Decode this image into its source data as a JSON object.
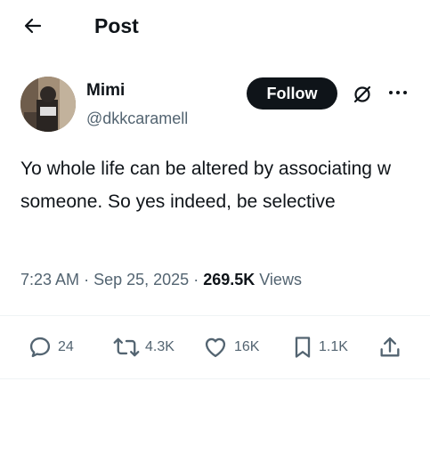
{
  "header": {
    "title": "Post"
  },
  "author": {
    "name": "Mimi",
    "handle": "@dkkcaramell"
  },
  "buttons": {
    "follow_label": "Follow"
  },
  "post": {
    "text": "Yo whole life can be altered by associating w someone. So yes indeed, be selective",
    "time": "7:23 AM",
    "date": "Sep 25, 2025",
    "views_count": "269.5K",
    "views_label": "Views"
  },
  "engagement": {
    "replies": "24",
    "reposts": "4.3K",
    "likes": "16K",
    "bookmarks": "1.1K"
  },
  "icons": [
    "back-arrow-icon",
    "grok-icon",
    "more-icon",
    "reply-icon",
    "repost-icon",
    "like-icon",
    "bookmark-icon",
    "share-icon"
  ],
  "colors": {
    "text": "#0f1419",
    "secondary": "#536471",
    "divider": "#eff3f4",
    "follow_bg": "#0f1419"
  }
}
